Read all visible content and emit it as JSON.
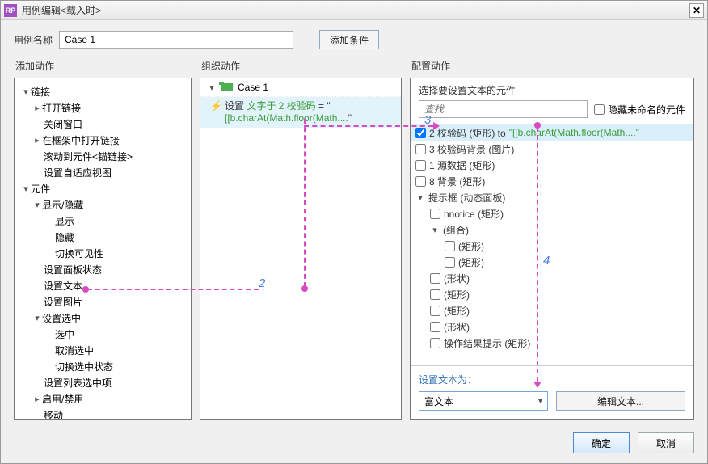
{
  "window": {
    "title": "用例编辑<载入时>",
    "icon_text": "RP"
  },
  "namerow": {
    "label": "用例名称",
    "value": "Case 1",
    "add_cond": "添加条件"
  },
  "cols": {
    "add": "添加动作",
    "org": "组织动作",
    "cfg": "配置动作"
  },
  "tree": {
    "groups": [
      {
        "label": "链接",
        "items": [
          {
            "label": "打开链接",
            "twisty": true
          },
          {
            "label": "关闭窗口"
          },
          {
            "label": "在框架中打开链接",
            "twisty": true
          },
          {
            "label": "滚动到元件<锚链接>"
          },
          {
            "label": "设置自适应视图"
          }
        ]
      },
      {
        "label": "元件",
        "items": [
          {
            "label": "显示/隐藏",
            "sub": [
              "显示",
              "隐藏",
              "切换可见性"
            ],
            "expanded": true
          },
          {
            "label": "设置面板状态"
          },
          {
            "label": "设置文本",
            "highlight": true
          },
          {
            "label": "设置图片"
          },
          {
            "label": "设置选中",
            "sub": [
              "选中",
              "取消选中",
              "切换选中状态"
            ],
            "expanded": true
          },
          {
            "label": "设置列表选中项"
          },
          {
            "label": "启用/禁用",
            "twisty": true
          },
          {
            "label": "移动"
          }
        ]
      }
    ]
  },
  "org": {
    "case": "Case 1",
    "action_prefix": "设置 ",
    "action_green1": "文字于 2 校验码",
    "action_mid": " = \"",
    "action_green2": "[[b.charAt(Math.floor(Math....",
    "action_tail": "\""
  },
  "cfg": {
    "select_title": "选择要设置文本的元件",
    "find_placeholder": "查找",
    "hide_unnamed": "隐藏未命名的元件",
    "rows": [
      {
        "indent": 0,
        "checked": true,
        "label": "2 校验码 (矩形) to ",
        "green": "\"[[b.charAt(Math.floor(Math....\"",
        "hi": true
      },
      {
        "indent": 0,
        "checked": false,
        "label": "3 校验码背景 (图片)"
      },
      {
        "indent": 0,
        "checked": false,
        "label": "1 源数据 (矩形)"
      },
      {
        "indent": 0,
        "checked": false,
        "label": "8 背景 (矩形)"
      },
      {
        "indent": 0,
        "group": true,
        "label": "提示框 (动态面板)"
      },
      {
        "indent": 1,
        "checked": false,
        "label": "hnotice (矩形)"
      },
      {
        "indent": 1,
        "group": true,
        "label": "(组合)"
      },
      {
        "indent": 2,
        "checked": false,
        "label": "(矩形)"
      },
      {
        "indent": 2,
        "checked": false,
        "label": "(矩形)"
      },
      {
        "indent": 1,
        "checked": false,
        "label": "(形状)"
      },
      {
        "indent": 1,
        "checked": false,
        "label": "(矩形)"
      },
      {
        "indent": 1,
        "checked": false,
        "label": "(矩形)"
      },
      {
        "indent": 1,
        "checked": false,
        "label": "(形状)"
      },
      {
        "indent": 1,
        "checked": false,
        "label": "操作结果提示 (矩形)"
      }
    ],
    "set_label": "设置文本为：",
    "select_value": "富文本",
    "edit_text": "编辑文本..."
  },
  "footer": {
    "ok": "确定",
    "cancel": "取消"
  },
  "anno": {
    "n2": "2",
    "n3": "3",
    "n4": "4"
  }
}
